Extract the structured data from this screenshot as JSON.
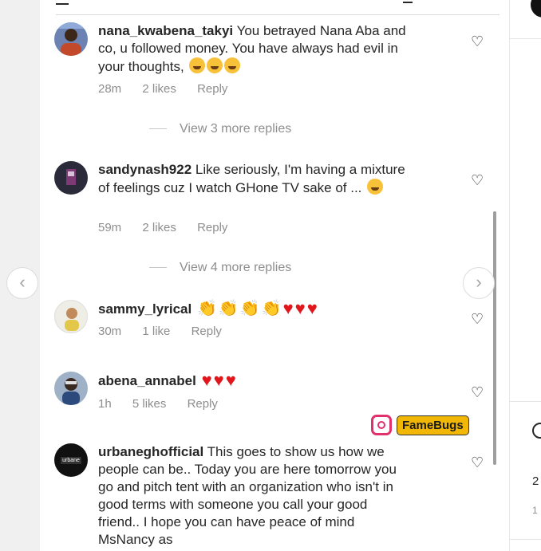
{
  "comments": [
    {
      "username": "nana_kwabena_takyi",
      "text": "You betrayed Nana Aba and co, u followed money. You have always had evil in your thoughts,",
      "emoji": "crying-face x3",
      "time": "28m",
      "likes": "2 likes",
      "reply": "Reply"
    },
    {
      "username": "sandynash922",
      "text": "Like seriously, I'm having a mixture of feelings cuz I watch GHone TV sake of ...",
      "emoji": "crying-face",
      "time": "59m",
      "likes": "2 likes",
      "reply": "Reply"
    },
    {
      "username": "sammy_lyrical",
      "text": "",
      "emoji": "clapping-hands x4, red-heart x3",
      "time": "30m",
      "likes": "1 like",
      "reply": "Reply"
    },
    {
      "username": "abena_annabel",
      "text": "",
      "emoji": "red-heart x3",
      "time": "1h",
      "likes": "5 likes",
      "reply": "Reply"
    },
    {
      "username": "urbaneghofficial",
      "text": "This goes to show us how we people can be.. Today you are here tomorrow you go and pitch tent with an organization who isn't in good terms with someone you call your good friend.. I hope you can have peace of mind MsNancy as",
      "emoji": "",
      "time": "",
      "likes": "",
      "reply": ""
    }
  ],
  "view_more": [
    "View 3 more replies",
    "View 4 more replies"
  ],
  "watermark": "FameBugs",
  "avatar_urbane_text": "urbane",
  "right_panel": {
    "text1": "2",
    "text2": "1"
  },
  "icons": {
    "like": "heart-outline-icon",
    "nav_left": "chevron-left-icon",
    "nav_right": "chevron-right-icon",
    "watermark": "instagram-icon"
  },
  "colors": {
    "heart_red": "#e0161b",
    "meta_gray": "#8e8e8e",
    "watermark_bg": "#f2b705"
  }
}
